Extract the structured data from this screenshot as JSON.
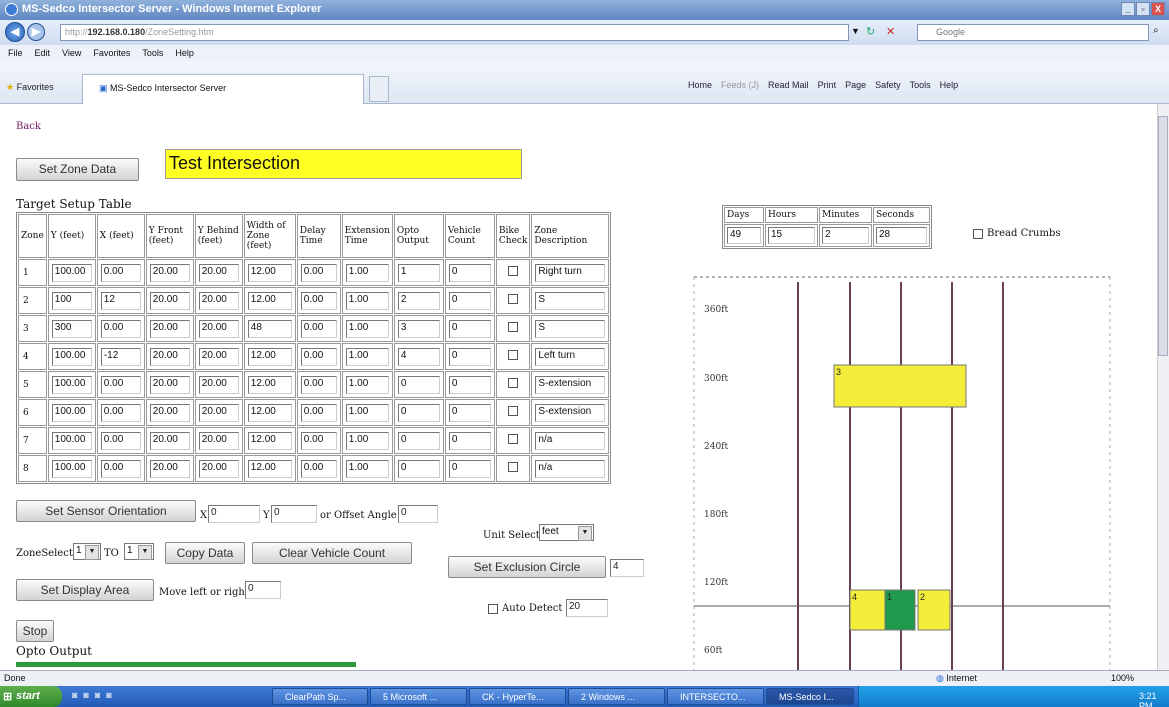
{
  "window": {
    "title": "MS-Sedco Intersector Server - Windows Internet Explorer",
    "controls": [
      "_",
      "▫",
      "X"
    ]
  },
  "browser": {
    "nav_back": "◀",
    "nav_forward": "▶",
    "address_prefix": "http://",
    "address_host": "192.168.0.180",
    "address_path": "/ZoneSetting.htm",
    "search_placeholder": "Google",
    "menu": [
      "File",
      "Edit",
      "View",
      "Favorites",
      "Tools",
      "Help"
    ],
    "favorites_label": "Favorites",
    "tab_title": "MS-Sedco Intersector Server",
    "commands": [
      "Home",
      "Feeds (J)",
      "Read Mail",
      "Print",
      "Page",
      "Safety",
      "Tools",
      "Help"
    ],
    "status_left": "Done",
    "status_zone": "Internet",
    "zoom": "100%"
  },
  "taskbar": {
    "start": "start",
    "items": [
      "ClearPath Sp...",
      "5 Microsoft ...",
      "CK - HyperTe...",
      "2 Windows ...",
      "INTERSECTO...",
      "MS-Sedco I..."
    ],
    "clock": "3:21 PM"
  },
  "page": {
    "back_link": "Back",
    "set_zone_data": "Set Zone Data",
    "intersection_name": "Test Intersection",
    "table_title": "Target Setup Table",
    "headers": [
      "Zone",
      "Y (feet)",
      "X (feet)",
      "Y Front (feet)",
      "Y Behind (feet)",
      "Width of Zone (feet)",
      "Delay Time",
      "Extension Time",
      "Opto Output",
      "Vehicle Count",
      "Bike Check",
      "Zone Description"
    ],
    "rows": [
      {
        "zone": "1",
        "y": "100.00",
        "x": "0.00",
        "yf": "20.00",
        "yb": "20.00",
        "w": "12.00",
        "delay": "0.00",
        "ext": "1.00",
        "opto": "1",
        "count": "0",
        "desc": "Right turn"
      },
      {
        "zone": "2",
        "y": "100",
        "x": "12",
        "yf": "20.00",
        "yb": "20.00",
        "w": "12.00",
        "delay": "0.00",
        "ext": "1.00",
        "opto": "2",
        "count": "0",
        "desc": "S"
      },
      {
        "zone": "3",
        "y": "300",
        "x": "0.00",
        "yf": "20.00",
        "yb": "20.00",
        "w": "48",
        "delay": "0.00",
        "ext": "1.00",
        "opto": "3",
        "count": "0",
        "desc": "S"
      },
      {
        "zone": "4",
        "y": "100.00",
        "x": "-12",
        "yf": "20.00",
        "yb": "20.00",
        "w": "12.00",
        "delay": "0.00",
        "ext": "1.00",
        "opto": "4",
        "count": "0",
        "desc": "Left turn"
      },
      {
        "zone": "5",
        "y": "100.00",
        "x": "0.00",
        "yf": "20.00",
        "yb": "20.00",
        "w": "12.00",
        "delay": "0.00",
        "ext": "1.00",
        "opto": "0",
        "count": "0",
        "desc": "S-extension"
      },
      {
        "zone": "6",
        "y": "100.00",
        "x": "0.00",
        "yf": "20.00",
        "yb": "20.00",
        "w": "12.00",
        "delay": "0.00",
        "ext": "1.00",
        "opto": "0",
        "count": "0",
        "desc": "S-extension"
      },
      {
        "zone": "7",
        "y": "100.00",
        "x": "0.00",
        "yf": "20.00",
        "yb": "20.00",
        "w": "12.00",
        "delay": "0.00",
        "ext": "1.00",
        "opto": "0",
        "count": "0",
        "desc": "n/a"
      },
      {
        "zone": "8",
        "y": "100.00",
        "x": "0.00",
        "yf": "20.00",
        "yb": "20.00",
        "w": "12.00",
        "delay": "0.00",
        "ext": "1.00",
        "opto": "0",
        "count": "0",
        "desc": "n/a"
      }
    ],
    "set_sensor_orientation": "Set Sensor Orientation",
    "x_label": "X",
    "x_value": "0",
    "y_label": "Y",
    "y_value": "0",
    "offset_label": "or Offset Angle",
    "offset_value": "0",
    "zone_select_label": "ZoneSelect",
    "zone_select_value": "1",
    "to_label": "TO",
    "to_value": "1",
    "copy_data": "Copy Data",
    "clear_vehicle_count": "Clear Vehicle Count",
    "set_display_area": "Set Display Area",
    "move_label": "Move left or right",
    "move_value": "0",
    "stop": "Stop",
    "opto_output_label": "Opto Output",
    "unit_select_label": "Unit Select",
    "unit_value": "feet",
    "set_exclusion_circle": "Set Exclusion Circle",
    "exclusion_value": "4",
    "auto_detect_label": "Auto Detect",
    "auto_detect_value": "20",
    "time_headers": [
      "Days",
      "Hours",
      "Minutes",
      "Seconds"
    ],
    "time_values": [
      "49",
      "15",
      "2",
      "28"
    ],
    "bread_crumbs_label": "Bread Crumbs"
  },
  "plot": {
    "y_tick_labels": [
      "360ft",
      "300ft",
      "240ft",
      "180ft",
      "120ft",
      "60ft"
    ],
    "zones": [
      {
        "label": "3",
        "fill": "yellow"
      },
      {
        "label": "4",
        "fill": "yellow"
      },
      {
        "label": "1",
        "fill": "green"
      },
      {
        "label": "2",
        "fill": "yellow"
      }
    ],
    "colors": {
      "zone_yellow": "#f2ee3a",
      "zone_green": "#1f9a4c",
      "lane_line": "#6b3e55"
    }
  }
}
